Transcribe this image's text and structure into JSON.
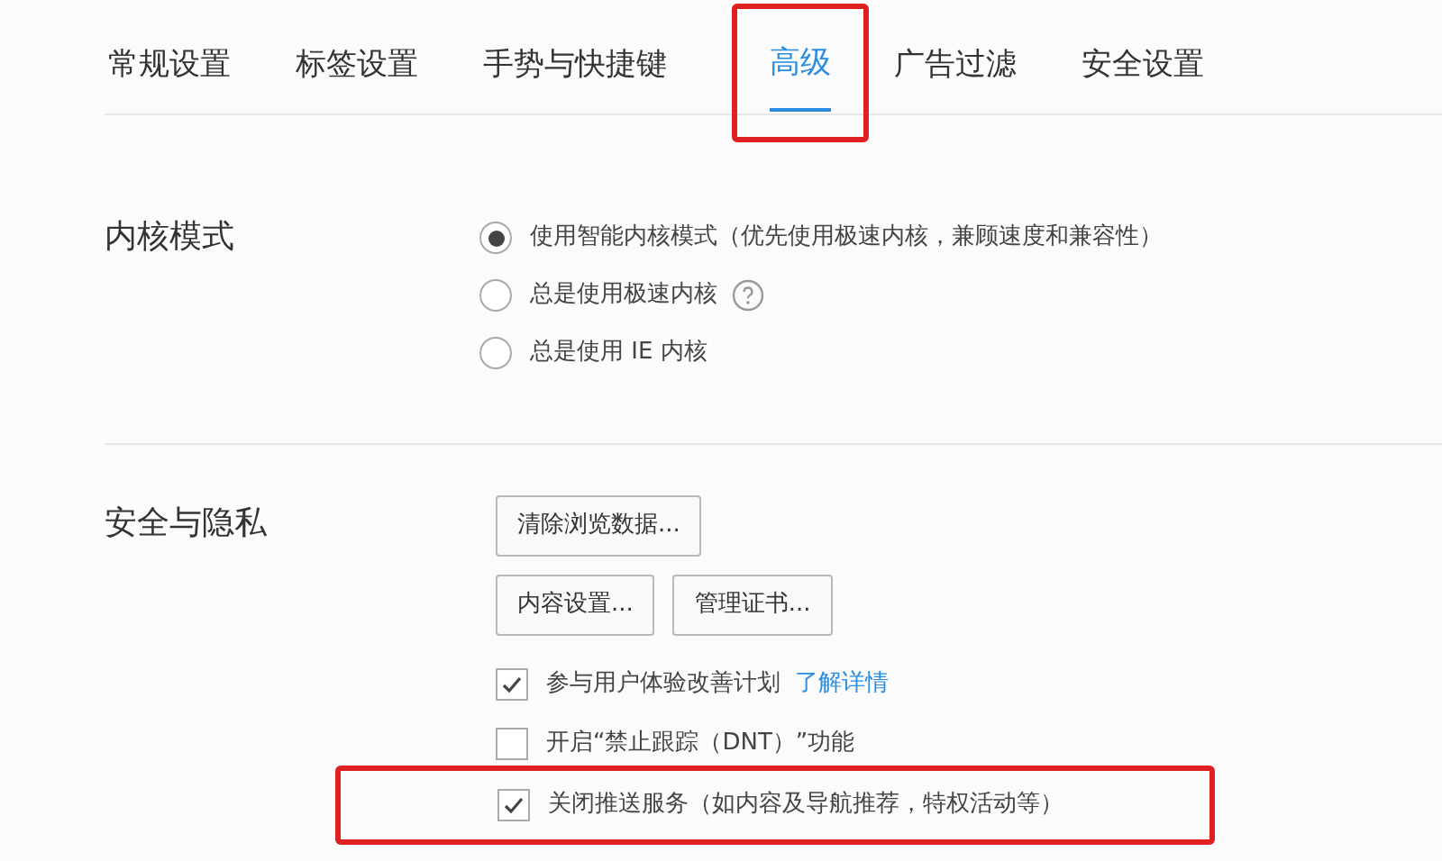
{
  "tabs": [
    {
      "label": "常规设置",
      "selected": false,
      "highlighted": false
    },
    {
      "label": "标签设置",
      "selected": false,
      "highlighted": false
    },
    {
      "label": "手势与快捷键",
      "selected": false,
      "highlighted": false
    },
    {
      "label": "高级",
      "selected": true,
      "highlighted": true
    },
    {
      "label": "广告过滤",
      "selected": false,
      "highlighted": false
    },
    {
      "label": "安全设置",
      "selected": false,
      "highlighted": false
    }
  ],
  "sections": [
    {
      "title": "内核模式",
      "items": [
        {
          "kind": "radio",
          "label": "使用智能内核模式（优先使用极速内核，兼顾速度和兼容性）",
          "selected": true
        },
        {
          "kind": "radio",
          "label": "总是使用极速内核",
          "selected": false,
          "help": true
        },
        {
          "kind": "radio",
          "label": "总是使用 IE 内核",
          "selected": false
        }
      ]
    },
    {
      "title": "安全与隐私",
      "items": [
        {
          "kind": "buttons",
          "buttons": [
            "清除浏览数据..."
          ]
        },
        {
          "kind": "buttons",
          "buttons": [
            "内容设置...",
            "管理证书..."
          ]
        },
        {
          "kind": "checkbox",
          "label": "参与用户体验改善计划",
          "link": "了解详情",
          "checked": true,
          "highlighted": false
        },
        {
          "kind": "checkbox",
          "label": "开启“禁止跟踪（DNT）”功能",
          "checked": false,
          "highlighted": false
        },
        {
          "kind": "checkbox",
          "label": "关闭推送服务（如内容及导航推荐，特权活动等）",
          "checked": true,
          "highlighted": true
        }
      ]
    }
  ]
}
